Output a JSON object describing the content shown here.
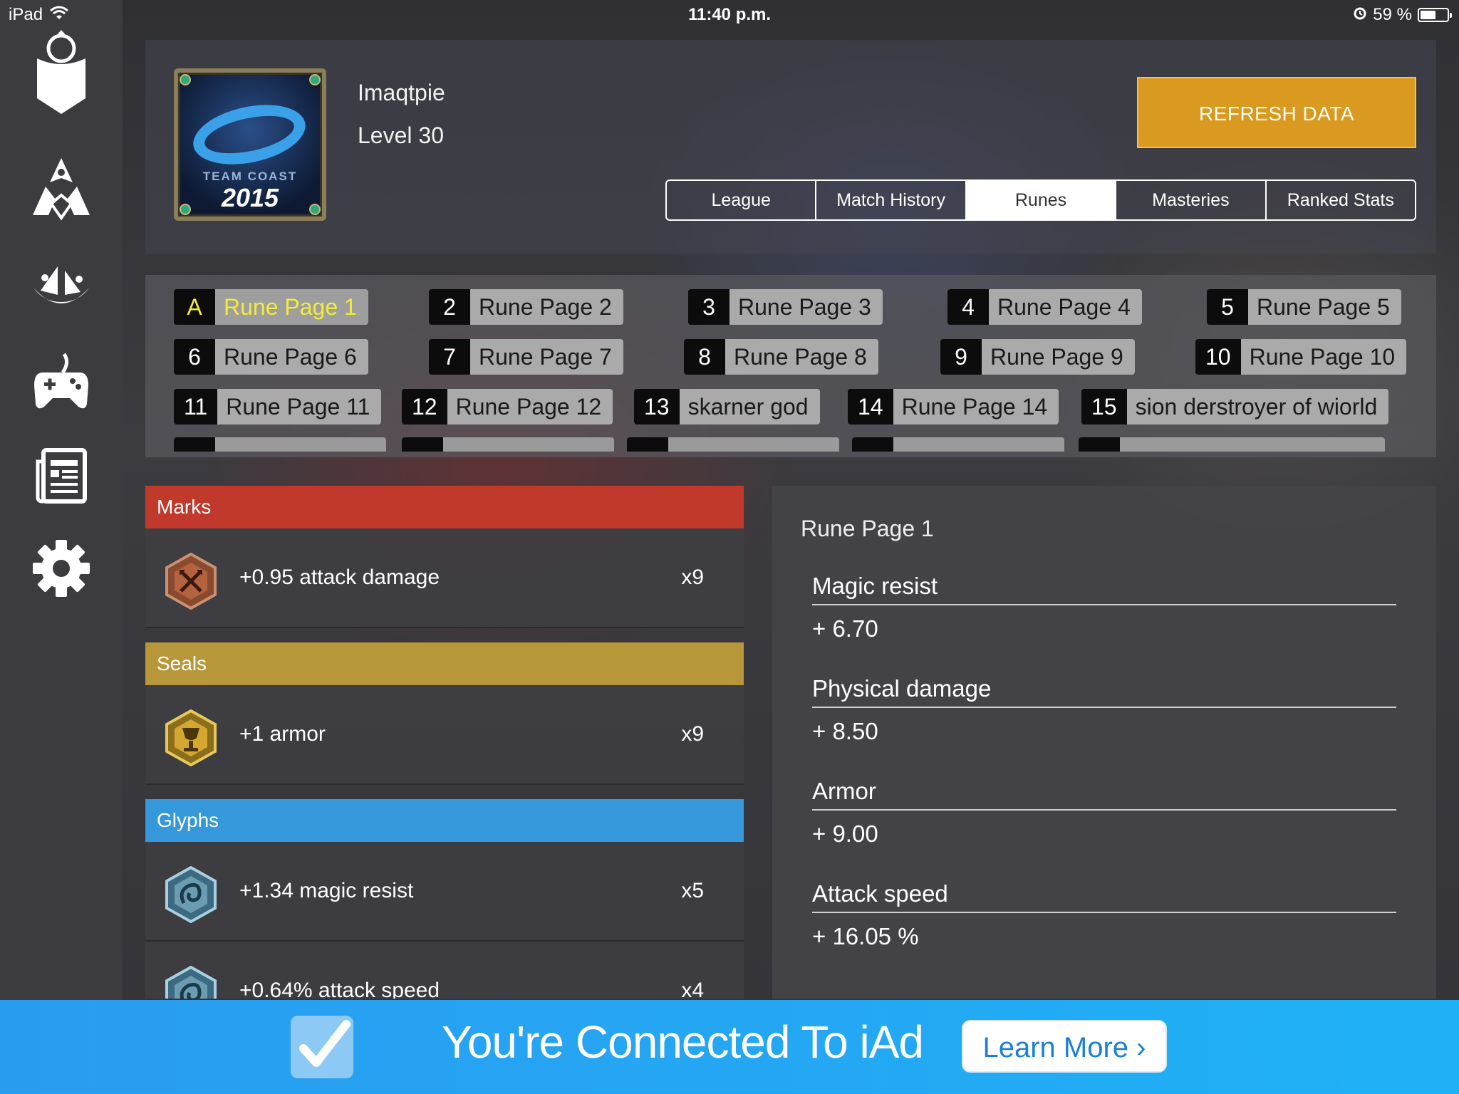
{
  "status_bar": {
    "device": "iPad",
    "time": "11:40 p.m.",
    "battery": "59 %",
    "battery_level": 0.59
  },
  "sidebar": {
    "items": [
      {
        "icon": "champion-helmet-icon"
      },
      {
        "icon": "crest-icon"
      },
      {
        "icon": "ship-icon"
      },
      {
        "icon": "gamepad-icon"
      },
      {
        "icon": "news-icon"
      },
      {
        "icon": "gear-icon"
      }
    ]
  },
  "header": {
    "avatar_text": {
      "team": "TEAM COAST",
      "year": "2015"
    },
    "player_name": "Imaqtpie",
    "player_level": "Level 30",
    "refresh_label": "REFRESH DATA",
    "tabs": [
      {
        "label": "League",
        "active": false
      },
      {
        "label": "Match History",
        "active": false
      },
      {
        "label": "Runes",
        "active": true
      },
      {
        "label": "Masteries",
        "active": false
      },
      {
        "label": "Ranked Stats",
        "active": false
      }
    ]
  },
  "rune_pages": [
    {
      "num": "A",
      "name": "Rune Page 1",
      "active": true
    },
    {
      "num": "2",
      "name": "Rune Page 2"
    },
    {
      "num": "3",
      "name": "Rune Page 3"
    },
    {
      "num": "4",
      "name": "Rune Page 4"
    },
    {
      "num": "5",
      "name": "Rune Page 5"
    },
    {
      "num": "6",
      "name": "Rune Page 6"
    },
    {
      "num": "7",
      "name": "Rune Page 7"
    },
    {
      "num": "8",
      "name": "Rune Page 8"
    },
    {
      "num": "9",
      "name": "Rune Page 9"
    },
    {
      "num": "10",
      "name": "Rune Page 10"
    },
    {
      "num": "11",
      "name": "Rune Page 11"
    },
    {
      "num": "12",
      "name": "Rune Page 12"
    },
    {
      "num": "13",
      "name": "skarner god"
    },
    {
      "num": "14",
      "name": "Rune Page 14"
    },
    {
      "num": "15",
      "name": "sion derstroyer of wiorld"
    }
  ],
  "runes": {
    "marks": {
      "title": "Marks",
      "color": "#c0392b",
      "items": [
        {
          "text": "+0.95 attack damage",
          "count": "x9",
          "icon": "mark-rune-icon"
        }
      ]
    },
    "seals": {
      "title": "Seals",
      "color": "#b8973a",
      "items": [
        {
          "text": "+1 armor",
          "count": "x9",
          "icon": "seal-rune-icon"
        }
      ]
    },
    "glyphs": {
      "title": "Glyphs",
      "color": "#3498db",
      "items": [
        {
          "text": "+1.34 magic resist",
          "count": "x5",
          "icon": "glyph-rune-icon"
        },
        {
          "text": "+0.64% attack speed",
          "count": "x4",
          "icon": "glyph-rune-icon"
        }
      ]
    }
  },
  "summary": {
    "title": "Rune Page 1",
    "stats": [
      {
        "label": "Magic resist",
        "value": "+ 6.70"
      },
      {
        "label": "Physical damage",
        "value": "+ 8.50"
      },
      {
        "label": "Armor",
        "value": "+ 9.00"
      },
      {
        "label": "Attack speed",
        "value": "+ 16.05 %"
      }
    ]
  },
  "ad_banner": {
    "text": "You're Connected To iAd",
    "button": "Learn More",
    "button_arrow": "›"
  }
}
